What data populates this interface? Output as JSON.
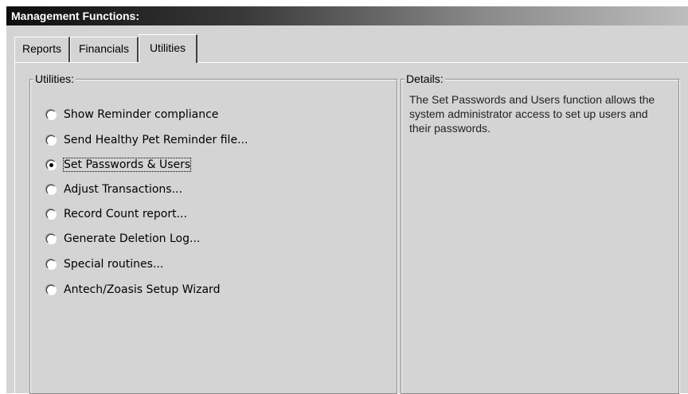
{
  "window": {
    "title": "Management Functions:"
  },
  "tabs": [
    {
      "label": "Reports"
    },
    {
      "label": "Financials"
    },
    {
      "label": "Utilities",
      "active": true
    }
  ],
  "utilities": {
    "group_label": "Utilities:",
    "selected": "Set Passwords & Users",
    "options": [
      {
        "label": "Show Reminder compliance"
      },
      {
        "label": "Send Healthy Pet Reminder file..."
      },
      {
        "label": "Set Passwords & Users",
        "checked": true
      },
      {
        "label": "Adjust Transactions..."
      },
      {
        "label": "Record Count report..."
      },
      {
        "label": "Generate Deletion Log..."
      },
      {
        "label": "Special routines..."
      },
      {
        "label": "Antech/Zoasis Setup Wizard"
      }
    ]
  },
  "details": {
    "group_label": "Details:",
    "text": "The Set Passwords and Users function allows the system administrator access to set up users and their passwords."
  }
}
